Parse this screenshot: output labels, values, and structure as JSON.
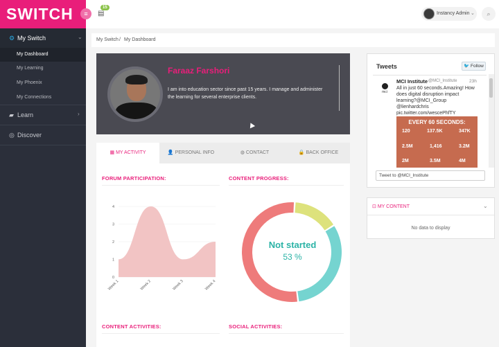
{
  "brand": {
    "logo_text": "SWITCH",
    "accent": "#e91e7a"
  },
  "header": {
    "menu_icon": "hamburger-icon",
    "tasks_badge": "15",
    "user_name": "Instancy Admin",
    "search_icon": "search-icon"
  },
  "sidebar": {
    "my_switch": "My Switch",
    "items": [
      "My Dashboard",
      "My Learning",
      "My Phoenix",
      "My Connections"
    ],
    "learn": "Learn",
    "discover": "Discover"
  },
  "breadcrumb": [
    "My Switch",
    "My Dashboard"
  ],
  "profile": {
    "name": "Faraaz Farshori",
    "bio": "I am into education sector since past 15 years. I manage and administer the learning for several enterprise clients."
  },
  "tabs": [
    {
      "label": "MY ACTIVITY",
      "icon": "▦"
    },
    {
      "label": "PERSONAL INFO",
      "icon": "👤"
    },
    {
      "label": "CONTACT",
      "icon": "◍"
    },
    {
      "label": "BACK OFFICE",
      "icon": "🔒"
    }
  ],
  "sections": {
    "forum": "FORUM PARTICIPATION:",
    "progress": "CONTENT PROGRESS:",
    "content_activities": "CONTENT ACTIVITIES:",
    "social_activities": "SOCIAL ACTIVITIES:"
  },
  "progress": {
    "label": "Not started",
    "percent": "53 %"
  },
  "chart_data": [
    {
      "type": "area",
      "title": "FORUM PARTICIPATION:",
      "categories": [
        "Week 1",
        "Week 2",
        "Week 3",
        "Week 4"
      ],
      "values": [
        1,
        4,
        1,
        2
      ],
      "y_ticks": [
        "0",
        "1",
        "2",
        "3",
        "4"
      ],
      "ylim": [
        0,
        4
      ],
      "color": "#f2c4c4"
    },
    {
      "type": "pie",
      "title": "CONTENT PROGRESS:",
      "values": [
        53,
        32,
        15
      ],
      "colors": [
        "#ee7b7b",
        "#75d4d0",
        "#dde27c"
      ]
    }
  ],
  "tweets": {
    "title": "Tweets",
    "follow_label": "Follow",
    "name": "MCI Institute",
    "handle": "@MCI_Institute",
    "time": "23h",
    "text": "All in just 60 seconds.Amazing! How does digital disruption impact learning?@MCI_Group @lienhardchris pic.twitter.com/wescePhfTY",
    "avatar_text": "mci",
    "image_title": "EVERY 60 SECONDS:",
    "image_stats": [
      "120",
      "137.5K",
      "347K",
      "2.5M",
      "1,416",
      "3.2M",
      "2M",
      "3.5M",
      "4M"
    ],
    "tweet_to": "Tweet to @MCI_Institute"
  },
  "my_content": {
    "title": "MY CONTENT",
    "empty": "No data to display"
  }
}
